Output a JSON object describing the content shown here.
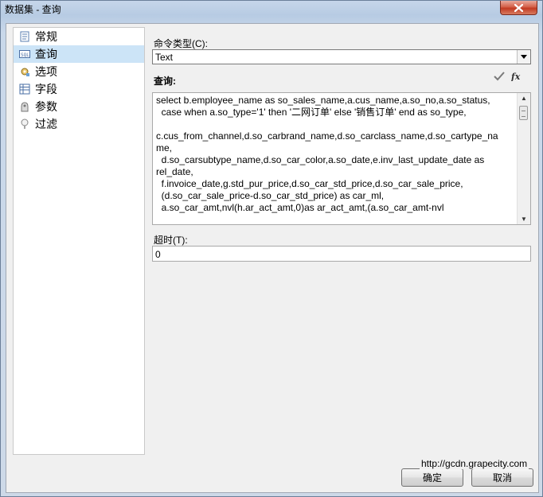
{
  "window": {
    "title": "数据集 - 查询"
  },
  "nav": {
    "items": [
      {
        "label": "常规",
        "icon": "general-icon",
        "selected": false
      },
      {
        "label": "查询",
        "icon": "query-icon",
        "selected": true
      },
      {
        "label": "选项",
        "icon": "options-icon",
        "selected": false
      },
      {
        "label": "字段",
        "icon": "fields-icon",
        "selected": false
      },
      {
        "label": "参数",
        "icon": "parameters-icon",
        "selected": false
      },
      {
        "label": "过滤",
        "icon": "filter-icon",
        "selected": false
      }
    ]
  },
  "command_type": {
    "label": "命令类型(C):",
    "value": "Text"
  },
  "query": {
    "label": "查询:",
    "lines": [
      "select b.employee_name as so_sales_name,a.cus_name,a.so_no,a.so_status,",
      "  case when a.so_type='1' then '二网订单' else '销售订单' end as so_type,",
      "",
      "c.cus_from_channel,d.so_carbrand_name,d.so_carclass_name,d.so_cartype_na",
      "me,",
      "  d.so_carsubtype_name,d.so_car_color,a.so_date,e.inv_last_update_date as",
      "rel_date,",
      "  f.invoice_date,g.std_pur_price,d.so_car_std_price,d.so_car_sale_price,",
      "  (d.so_car_sale_price-d.so_car_std_price) as car_ml,",
      "  a.so_car_amt,nvl(h.ar_act_amt,0)as ar_act_amt,(a.so_car_amt-nvl"
    ]
  },
  "timeout": {
    "label": "超时(T):",
    "value": "0"
  },
  "buttons": {
    "ok": "确定",
    "cancel": "取消"
  },
  "watermark": "http://gcdn.grapecity.com"
}
